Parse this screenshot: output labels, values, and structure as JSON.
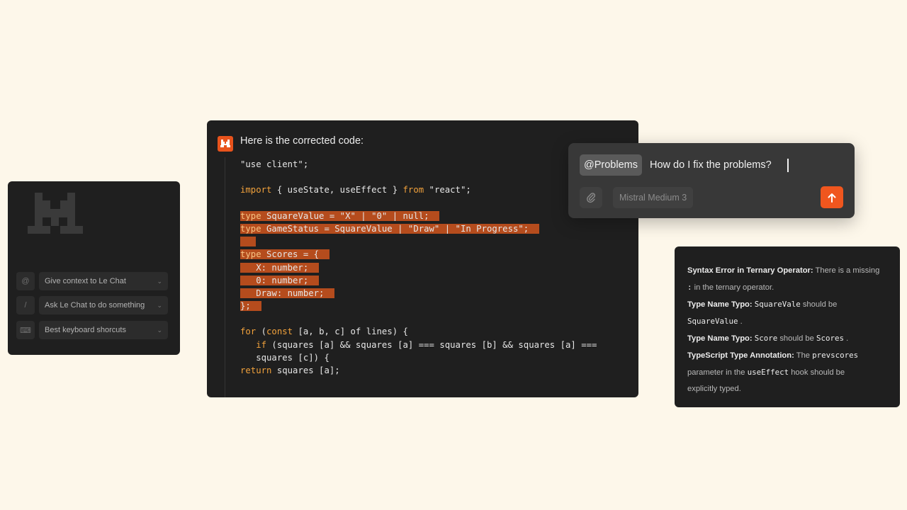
{
  "left_panel": {
    "items": [
      {
        "icon": "at-icon",
        "glyph": "@",
        "label": "Give context to Le Chat"
      },
      {
        "icon": "slash-icon",
        "glyph": "/",
        "label": "Ask Le Chat to do something"
      },
      {
        "icon": "keyboard-icon",
        "glyph": "⌨",
        "label": "Best keyboard shorcuts"
      }
    ]
  },
  "chat": {
    "response_title": "Here is the corrected code:",
    "code_lines": [
      {
        "code": "\"use client\";"
      },
      {
        "code": ""
      },
      {
        "code": "import { useState, useEffect } from \"react\";"
      },
      {
        "code": ""
      },
      {
        "code": "type SquareValue = \"X\" | \"0\" | null;"
      },
      {
        "code": "type GameStatus = SquareValue | \"Draw\" | \"In Progress\";"
      },
      {
        "code": ""
      },
      {
        "code": "type Scores = {"
      },
      {
        "code": "   X: number;"
      },
      {
        "code": "   0: number;"
      },
      {
        "code": "   Draw: number;"
      },
      {
        "code": "};"
      },
      {
        "code": ""
      },
      {
        "code": "for (const [a, b, c] of lines) {"
      },
      {
        "code": "   if (squares [a] && squares [a] === squares [b] && squares [a] ==="
      },
      {
        "code": "   squares [c]) {"
      },
      {
        "code": "return squares [a];"
      }
    ]
  },
  "ask_box": {
    "mention": "@Problems",
    "prompt": "How do I fix the problems?",
    "model": "Mistral Medium 3"
  },
  "problems": {
    "p1_title": "Syntax Error in Ternary Operator:",
    "p1_text_a": " There is a missing",
    "p1_code": ":",
    "p1_text_b": " in the ternary operator.",
    "p2_title": "Type Name Typo:",
    "p2_code_a": "SquareVale",
    "p2_text_a": " should be",
    "p2_code_b": "SquareValue",
    "p2_text_b": " .",
    "p3_title": "Type Name Typo:",
    "p3_code_a": "Score",
    "p3_text_a": " should be ",
    "p3_code_b": "Scores",
    "p3_text_b": " .",
    "p4_title": "TypeScript Type Annotation:",
    "p4_text_a": " The ",
    "p4_code_a": "prevscores",
    "p4_text_b": "parameter in the ",
    "p4_code_b": "useEffect",
    "p4_text_c": "  hook should be",
    "p4_text_d": "explicitly typed."
  },
  "colors": {
    "background": "#fdf7ea",
    "panel": "#1f1f1f",
    "accent": "#f0561e",
    "highlight": "#b54c1d",
    "keyword": "#f2a23c"
  }
}
